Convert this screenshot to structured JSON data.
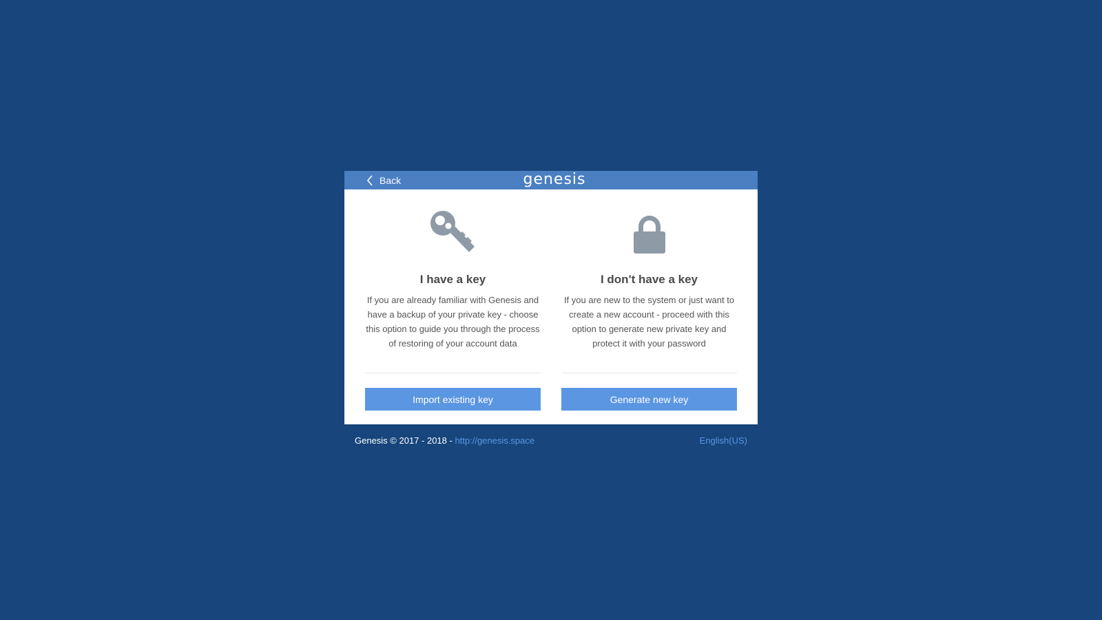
{
  "header": {
    "back_label": "Back",
    "logo_text": "genesis"
  },
  "panels": [
    {
      "icon": "key-icon",
      "title": "I have a key",
      "description": "If you are already familiar with Genesis and have a backup of your private key - choose this option to guide you through the process of restoring of your account data",
      "button_label": "Import existing key"
    },
    {
      "icon": "lock-icon",
      "title": "I don't have a key",
      "description": "If you are new to the system or just want to create a new account - proceed with this option to generate new private key and protect it with your password",
      "button_label": "Generate new key"
    }
  ],
  "footer": {
    "copyright": "Genesis © 2017 - 2018 - ",
    "link_text": "http://genesis.space",
    "language": "English(US)"
  },
  "colors": {
    "background": "#17457c",
    "header": "#4a7fc1",
    "button": "#5b96e2",
    "icon": "#8e9aa6"
  }
}
